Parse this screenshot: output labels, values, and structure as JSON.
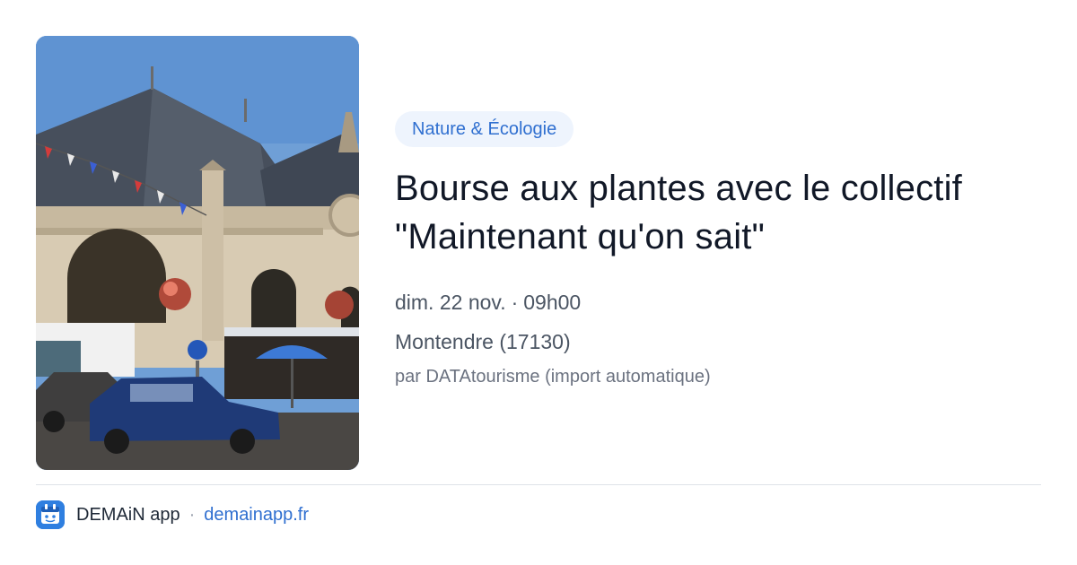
{
  "event": {
    "category": "Nature & Écologie",
    "title_line1": "Bourse aux plantes avec le collectif",
    "title_line2": "\"Maintenant qu'on sait\"",
    "date": "dim. 22 nov.",
    "separator": "·",
    "time": "09h00",
    "location": "Montendre (17130)",
    "author": "par DATAtourisme (import automatique)"
  },
  "footer": {
    "app_name": "DEMAiN app",
    "separator": "·",
    "domain": "demainapp.fr"
  },
  "photo": {
    "icon": "photo-market-hall",
    "sky_color": "#6f9fd6",
    "roof_color": "#4b5563",
    "stone_color": "#d8cbb3"
  },
  "colors": {
    "accent": "#2f6fd0",
    "pill_bg": "#eef4fd",
    "text_primary": "#111827",
    "text_secondary": "#4b5563"
  }
}
